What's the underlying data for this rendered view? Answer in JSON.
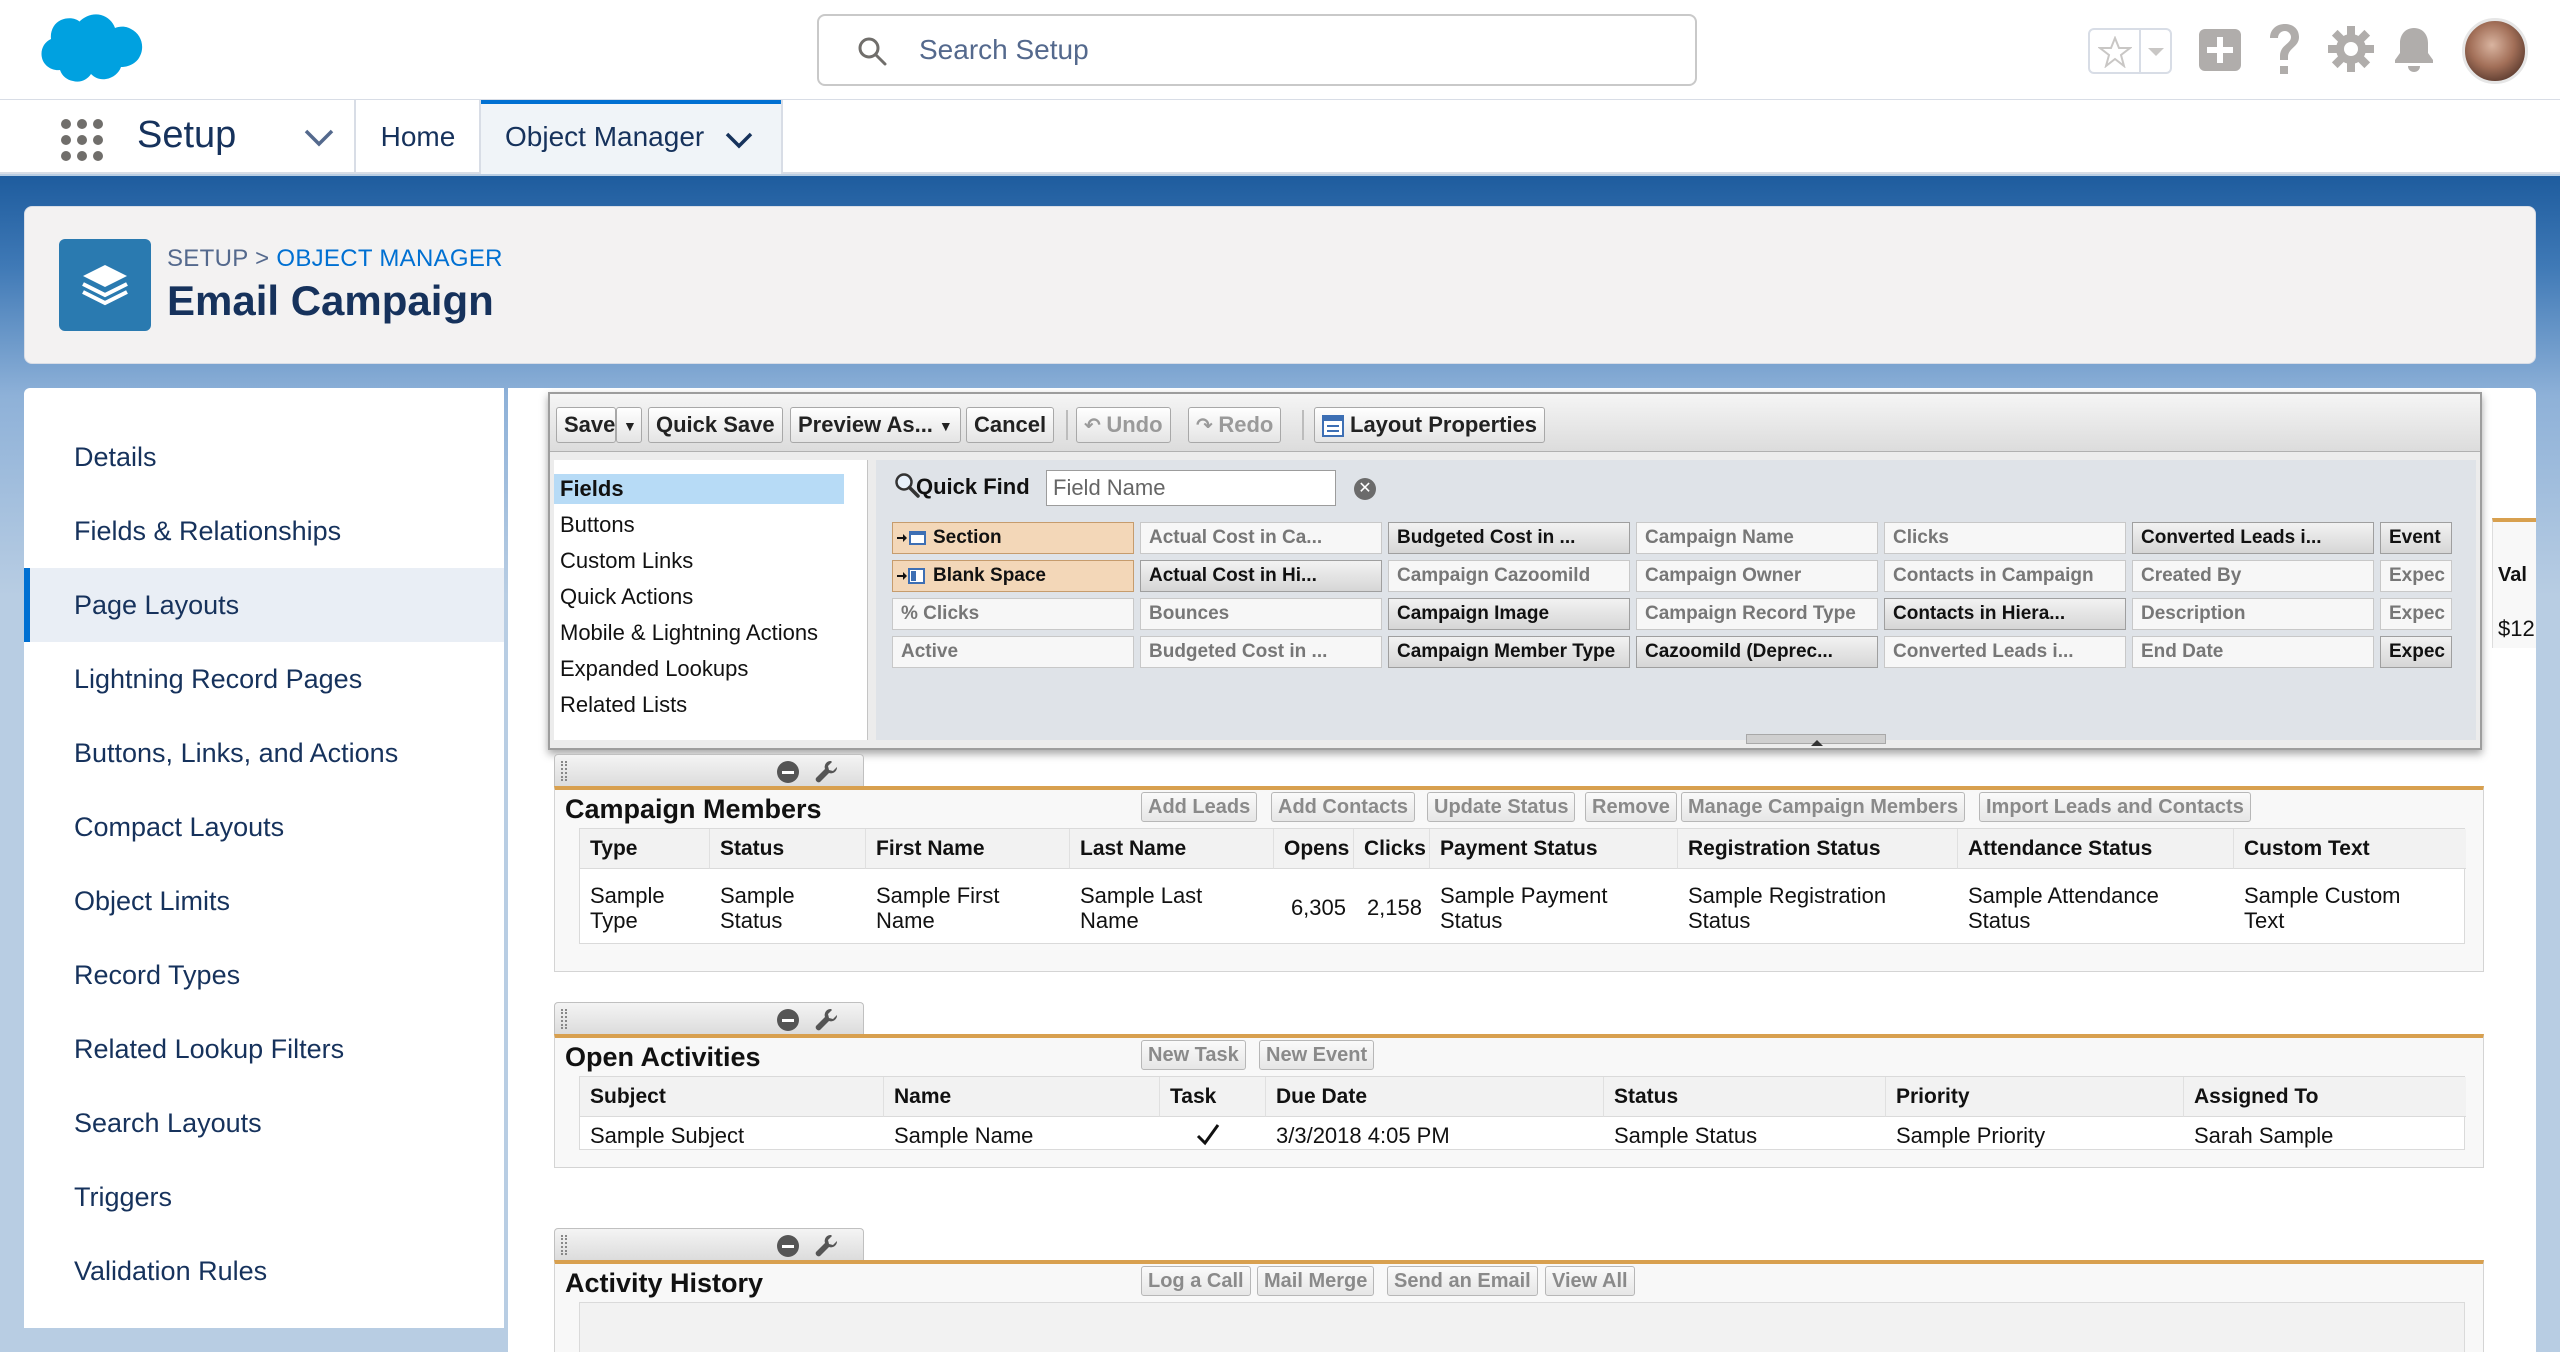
{
  "header": {
    "search_placeholder": "Search Setup"
  },
  "nav": {
    "app_name": "Setup",
    "home_tab": "Home",
    "object_manager_tab": "Object Manager"
  },
  "page_header": {
    "crumb_setup": "SETUP",
    "crumb_sep": ">",
    "crumb_object_manager": "OBJECT MANAGER",
    "title": "Email Campaign"
  },
  "sidebar": {
    "items": [
      {
        "label": "Details"
      },
      {
        "label": "Fields & Relationships"
      },
      {
        "label": "Page Layouts"
      },
      {
        "label": "Lightning Record Pages"
      },
      {
        "label": "Buttons, Links, and Actions"
      },
      {
        "label": "Compact Layouts"
      },
      {
        "label": "Object Limits"
      },
      {
        "label": "Record Types"
      },
      {
        "label": "Related Lookup Filters"
      },
      {
        "label": "Search Layouts"
      },
      {
        "label": "Triggers"
      },
      {
        "label": "Validation Rules"
      }
    ],
    "active_index": 2
  },
  "toolbar": {
    "save": "Save",
    "quick_save": "Quick Save",
    "preview_as": "Preview As...",
    "cancel": "Cancel",
    "undo": "Undo",
    "redo": "Redo",
    "layout_properties": "Layout Properties"
  },
  "palette": {
    "categories": [
      "Fields",
      "Buttons",
      "Custom Links",
      "Quick Actions",
      "Mobile & Lightning Actions",
      "Expanded Lookups",
      "Related Lists"
    ],
    "quick_find_label": "Quick Find",
    "quick_find_placeholder": "Field Name",
    "fields": [
      [
        "Section",
        "Blank Space",
        "% Clicks",
        "Active"
      ],
      [
        "Actual Cost in Ca...",
        "Actual Cost in Hi...",
        "Bounces",
        "Budgeted Cost in ..."
      ],
      [
        "Budgeted Cost in ...",
        "Campaign Cazoomild",
        "Campaign Image",
        "Campaign Member Type"
      ],
      [
        "Campaign Name",
        "Campaign Owner",
        "Campaign Record Type",
        "Cazoomild (Deprec..."
      ],
      [
        "Clicks",
        "Contacts in Campaign",
        "Contacts in Hiera...",
        "Converted Leads i..."
      ],
      [
        "Converted Leads i...",
        "Created By",
        "Description",
        "End Date"
      ],
      [
        "Event",
        "Expec",
        "Expec",
        "Expec"
      ]
    ]
  },
  "right_stub": {
    "col": "Val",
    "val": "$12"
  },
  "campaign_members": {
    "title": "Campaign Members",
    "buttons": [
      "Add Leads",
      "Add Contacts",
      "Update Status",
      "Remove",
      "Manage Campaign Members",
      "Import Leads and Contacts"
    ],
    "columns": [
      "Type",
      "Status",
      "First Name",
      "Last Name",
      "Opens",
      "Clicks",
      "Payment Status",
      "Registration Status",
      "Attendance Status",
      "Custom Text"
    ],
    "row": [
      [
        "Sample",
        "Type"
      ],
      [
        "Sample",
        "Status"
      ],
      [
        "Sample First",
        "Name"
      ],
      [
        "Sample Last",
        "Name"
      ],
      [
        "6,305"
      ],
      [
        "2,158"
      ],
      [
        "Sample Payment",
        "Status"
      ],
      [
        "Sample Registration",
        "Status"
      ],
      [
        "Sample Attendance",
        "Status"
      ],
      [
        "Sample Custom",
        "Text"
      ]
    ]
  },
  "open_activities": {
    "title": "Open Activities",
    "buttons": [
      "New Task",
      "New Event"
    ],
    "columns": [
      "Subject",
      "Name",
      "Task",
      "Due Date",
      "Status",
      "Priority",
      "Assigned To"
    ],
    "row": [
      "Sample Subject",
      "Sample Name",
      "",
      "3/3/2018 4:05 PM",
      "Sample Status",
      "Sample Priority",
      "Sarah Sample"
    ]
  },
  "activity_history": {
    "title": "Activity History",
    "buttons": [
      "Log a Call",
      "Mail Merge",
      "Send an Email",
      "View All"
    ]
  }
}
